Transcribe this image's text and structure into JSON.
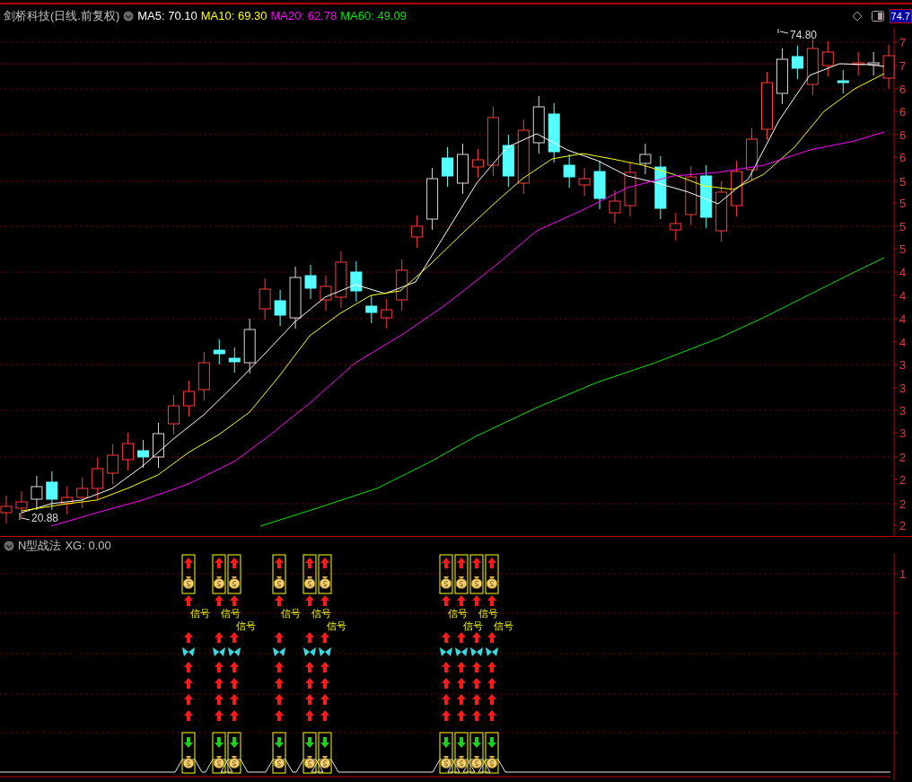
{
  "header": {
    "title": "剑桥科技(日线.前复权)",
    "indicators": [
      {
        "label": "MA5: 70.10",
        "color": "#ffffff"
      },
      {
        "label": "MA10: 69.30",
        "color": "#ffff00"
      },
      {
        "label": "MA20: 62.78",
        "color": "#ff00ff"
      },
      {
        "label": "MA60: 49.09",
        "color": "#00e600"
      }
    ],
    "current_price": "74.7"
  },
  "price_axis": {
    "labels": [
      "7",
      "7",
      "6",
      "6",
      "6",
      "6",
      "5",
      "5",
      "5",
      "5",
      "4",
      "4",
      "4",
      "4",
      "3",
      "3",
      "3",
      "3",
      "2",
      "2",
      "2",
      "2"
    ]
  },
  "annotations": {
    "high": "74.80",
    "low": "20.88"
  },
  "indicator_panel": {
    "title": "N型战法",
    "value": "XG: 0.00",
    "axis_labels": [
      "1"
    ],
    "signal_groups": [
      {
        "signals": [
          {
            "label": "信号"
          }
        ]
      },
      {
        "signals": [
          {
            "label": "信号"
          },
          {
            "label": "信号"
          }
        ]
      },
      {
        "signals": [
          {
            "label": "信号"
          }
        ]
      },
      {
        "signals": [
          {
            "label": "信号"
          },
          {
            "label": "信号"
          }
        ]
      },
      {
        "signals": [
          {
            "label": "信号"
          },
          {
            "label": "信号"
          },
          {
            "label": "信号"
          },
          {
            "label": "信号"
          }
        ]
      }
    ]
  }
}
